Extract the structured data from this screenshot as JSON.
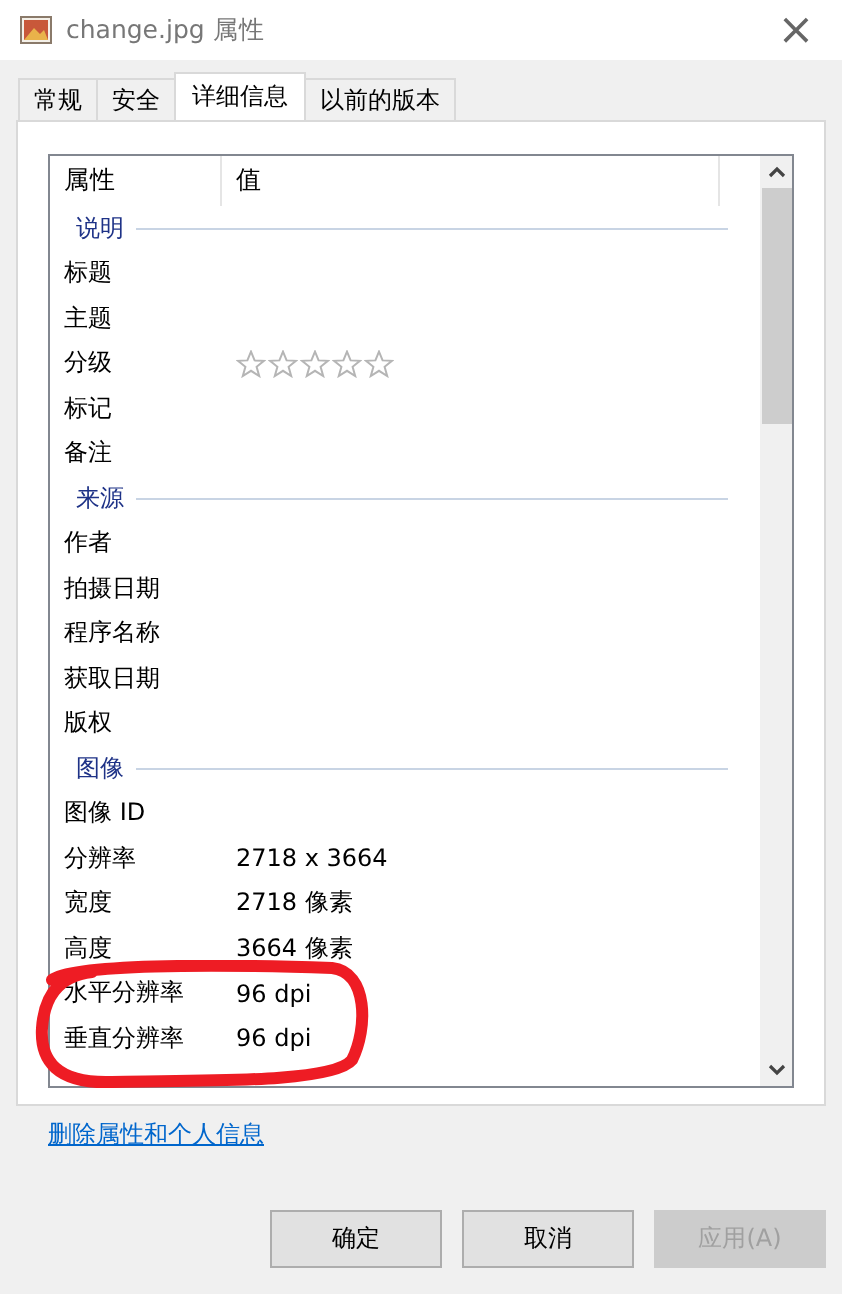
{
  "window": {
    "title": "change.jpg 属性",
    "close": "×"
  },
  "tabs": [
    {
      "label": "常规",
      "selected": false
    },
    {
      "label": "安全",
      "selected": false
    },
    {
      "label": "详细信息",
      "selected": true
    },
    {
      "label": "以前的版本",
      "selected": false
    }
  ],
  "table": {
    "columns": [
      "属性",
      "值"
    ],
    "rows": [
      {
        "kind": "group",
        "name": "说明"
      },
      {
        "kind": "property",
        "name": "标题"
      },
      {
        "kind": "property",
        "name": "主题"
      },
      {
        "kind": "rating",
        "name": "分级",
        "stars": 0
      },
      {
        "kind": "property",
        "name": "标记"
      },
      {
        "kind": "property",
        "name": "备注"
      },
      {
        "kind": "group",
        "name": "来源"
      },
      {
        "kind": "property",
        "name": "作者"
      },
      {
        "kind": "property",
        "name": "拍摄日期"
      },
      {
        "kind": "property",
        "name": "程序名称"
      },
      {
        "kind": "property",
        "name": "获取日期"
      },
      {
        "kind": "property",
        "name": "版权"
      },
      {
        "kind": "group",
        "name": "图像"
      },
      {
        "kind": "property",
        "name": "图像 ID"
      },
      {
        "kind": "property",
        "name": "分辨率",
        "value": "2718 x 3664"
      },
      {
        "kind": "property",
        "name": "宽度",
        "value": "2718 像素"
      },
      {
        "kind": "property",
        "name": "高度",
        "value": "3664 像素"
      },
      {
        "kind": "property",
        "name": "水平分辨率",
        "value": "96 dpi"
      },
      {
        "kind": "property",
        "name": "垂直分辨率",
        "value": "96 dpi"
      }
    ]
  },
  "link": "删除属性和个人信息",
  "buttons": [
    {
      "label": "确定",
      "disabled": false
    },
    {
      "label": "取消",
      "disabled": false
    },
    {
      "label": "应用(A)",
      "disabled": true
    }
  ]
}
